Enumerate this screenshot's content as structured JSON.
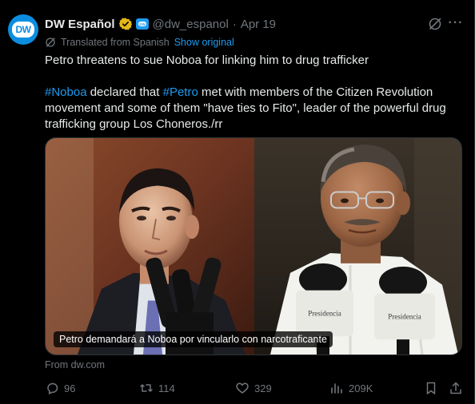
{
  "author": {
    "display_name": "DW Español",
    "handle": "@dw_espanol",
    "separator": "·",
    "date": "Apr 19",
    "avatar_text": "DW"
  },
  "translation": {
    "label": "Translated from Spanish",
    "show_original": "Show original"
  },
  "post": {
    "headline": "Petro threatens to sue Noboa for linking him to drug trafficker",
    "body_hashtag_1": "#Noboa",
    "body_part_1": " declared that ",
    "body_hashtag_2": "#Petro",
    "body_part_2": " met with members of the Citizen Revolution movement and some of them \"have ties to Fito\", leader of the powerful drug trafficking group Los Choneros./rr"
  },
  "media": {
    "caption": "Petro demandará a Noboa por vincularlo con narcotraficante",
    "mic_label_1": "Presidencia",
    "mic_label_2": "Presidencia"
  },
  "card_source": "From dw.com",
  "actions": {
    "replies": "96",
    "reposts": "114",
    "likes": "329",
    "views": "209K"
  },
  "colors": {
    "link": "#1d9bf0",
    "muted": "#71767b",
    "text": "#e7e9ea",
    "background": "#000000",
    "brand": "#0c8ee0"
  }
}
